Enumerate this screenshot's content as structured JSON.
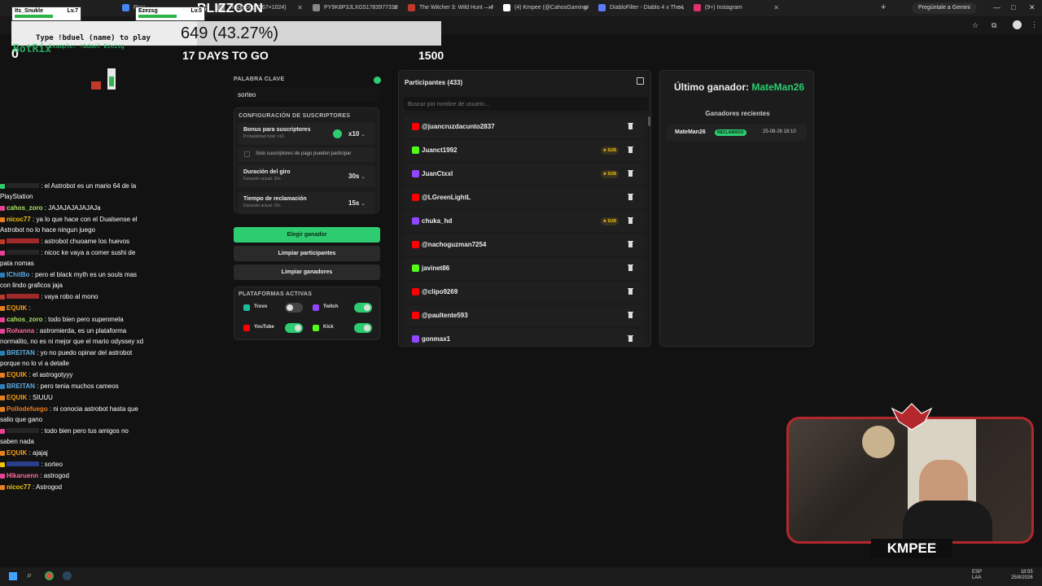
{
  "browser": {
    "tabs": [
      {
        "label": "Prec",
        "color": "#4285f4"
      },
      {
        "label": "image.png (567×1024)",
        "color": "#888888"
      },
      {
        "label": "PY9K8P3JLXG5178397731077",
        "color": "#888888"
      },
      {
        "label": "The Witcher 3: Wild Hunt — R",
        "color": "#c0392b"
      },
      {
        "label": "(4) Kmpee (@CahosGamingAI",
        "color": "#ffffff"
      },
      {
        "label": "DiabloFilter - Diablo 4 x The W",
        "color": "#5b7cfa"
      },
      {
        "label": "(9+) Instagram",
        "color": "#e1306c"
      }
    ],
    "gemini_label": "Pregúntale a Gemini"
  },
  "overlay": {
    "game_title": "BLIZZCON",
    "goal_text": "649 (43.27%)",
    "goal_fraction": 0.4327,
    "days_text": "17 DAYS TO GO",
    "goal_target": "1500",
    "goal_current": "0",
    "duel_hint": "Type !bduel (name) to play",
    "duel_example": "Example: !bduel Ezezsg",
    "player1": "Its_Snukle",
    "player1_level": "Lv.7",
    "player2": "Ezezsg",
    "player2_level": "Lv.5",
    "streamer": "KMPEE",
    "bot_name": "BotRix"
  },
  "chat": [
    {
      "user": "",
      "text": "el Astrobot es un mario 64 de la PlayStation",
      "color": "#ffffff",
      "badge": "#2ecc71"
    },
    {
      "user": "cahos_zoro",
      "text": "JAJAJAJAJAJAJa",
      "color": "#a8e063",
      "badge": "#e84393"
    },
    {
      "user": "nicoc77",
      "text": "ya lo que hace con el Dualsense el Astrobot no lo hace ningun juego",
      "color": "#f1c40f",
      "badge": "#e67e22"
    },
    {
      "user": "",
      "text": "astrobot chuoame los huevos",
      "color": "#ff3b3b",
      "badge": "#c0392b"
    },
    {
      "user": "",
      "text": "nicoc ke vaya a comer sushi de pata nomas",
      "color": "#ffffff",
      "badge": "#e84393"
    },
    {
      "user": "IChitBo",
      "text": "pero el black myth es un souls mas con lindo graficos jaja",
      "color": "#5dade2",
      "badge": "#2980b9"
    },
    {
      "user": "",
      "text": "vaya robo al mono",
      "color": "#ff3b3b",
      "badge": "#c0392b"
    },
    {
      "user": "EQUIK",
      "text": "",
      "color": "#f39c12",
      "badge": "#e67e22"
    },
    {
      "user": "cahos_zoro",
      "text": "todo bien pero xupenmela",
      "color": "#a8e063",
      "badge": "#e84393"
    },
    {
      "user": "Rohanna",
      "text": "astromierda, es un plataforma normalito, no es ni mejor que el mario odyssey xd",
      "color": "#ff6b9d",
      "badge": "#e84393"
    },
    {
      "user": "BREITAN",
      "text": "yo no puedo opinar del astrobot porque no lo vi a detalle",
      "color": "#5dade2",
      "badge": "#2980b9"
    },
    {
      "user": "EQUIK",
      "text": "el astrogotyyy",
      "color": "#f39c12",
      "badge": "#e67e22"
    },
    {
      "user": "BREITAN",
      "text": "pero tenia muchos cameos",
      "color": "#5dade2",
      "badge": "#2980b9"
    },
    {
      "user": "EQUIK",
      "text": "SIUUU",
      "color": "#f39c12",
      "badge": "#e67e22"
    },
    {
      "user": "Pollodefuego",
      "text": "ni conocia astrobot hasta que salio que gano",
      "color": "#e67e22",
      "badge": "#e67e22"
    },
    {
      "user": "",
      "text": "todo bien pero tus amigos no saben nada",
      "color": "#ffffff",
      "badge": "#e84393"
    },
    {
      "user": "EQUIK",
      "text": "ajajaj",
      "color": "#f39c12",
      "badge": "#e67e22"
    },
    {
      "user": "",
      "text": "sorteo",
      "color": "#3b5bdb",
      "badge": "#f1c40f"
    },
    {
      "user": "Hikaruenn",
      "text": "astrogod",
      "color": "#ff6b9d",
      "badge": "#e84393"
    },
    {
      "user": "nicoc77",
      "text": "Astrogod",
      "color": "#f1c40f",
      "badge": "#e67e22"
    }
  ],
  "settings": {
    "keyword_label": "PALABRA CLAVE",
    "keyword_value": "sorteo",
    "subs_config_label": "CONFIGURACIÓN DE SUSCRIPTORES",
    "bonus_title": "Bonus para suscriptores",
    "bonus_sub": "Probabilidad total: x10",
    "bonus_value": "x10",
    "only_subs_label": "Solo suscriptores de pago pueden participar",
    "spin_title": "Duración del giro",
    "spin_sub": "Duración actual: 30s",
    "spin_value": "30s",
    "claim_title": "Tiempo de reclamación",
    "claim_sub": "Duración actual: 15s",
    "claim_value": "15s",
    "pick_winner": "Elegir ganador",
    "clear_participants": "Limpiar participantes",
    "clear_winners": "Limpiar ganadores",
    "platforms_label": "PLATAFORMAS ACTIVAS",
    "platforms": [
      {
        "name": "Trovo",
        "on": false,
        "color": "#1abc9c"
      },
      {
        "name": "Twitch",
        "on": true,
        "color": "#9146ff"
      },
      {
        "name": "YouTube",
        "on": true,
        "color": "#ff0000"
      },
      {
        "name": "Kick",
        "on": true,
        "color": "#53fc18"
      }
    ]
  },
  "participants": {
    "title": "Participantes (433)",
    "search_placeholder": "Buscar por nombre de usuario...",
    "sub_badge": "SUB",
    "list": [
      {
        "name": "@juancruzdacunto2837",
        "platform": "youtube",
        "sub": false
      },
      {
        "name": "Juanct1992",
        "platform": "kick",
        "sub": true
      },
      {
        "name": "JuanCtxxl",
        "platform": "twitch",
        "sub": true
      },
      {
        "name": "@LGreenLightL",
        "platform": "youtube",
        "sub": false
      },
      {
        "name": "chuka_hd",
        "platform": "twitch",
        "sub": true
      },
      {
        "name": "@nachoguzman7254",
        "platform": "youtube",
        "sub": false
      },
      {
        "name": "javinet86",
        "platform": "kick",
        "sub": false
      },
      {
        "name": "@clipo9269",
        "platform": "youtube",
        "sub": false
      },
      {
        "name": "@paultente593",
        "platform": "youtube",
        "sub": false
      },
      {
        "name": "gonmax1",
        "platform": "twitch",
        "sub": false
      }
    ]
  },
  "winner": {
    "last_label": "Último ganador:",
    "last_name": "MateMan26",
    "recent_label": "Ganadores recientes",
    "recent": [
      {
        "name": "MateMan26",
        "status": "RECLAMADO",
        "date": "25-08-26 18:10"
      }
    ]
  },
  "taskbar": {
    "lang": "ESP",
    "lang2": "LAA",
    "time": "18:55",
    "date": "25/8/2026"
  },
  "colors": {
    "accent": "#2ecc71",
    "youtube": "#ff0000",
    "kick": "#53fc18",
    "twitch": "#9146ff"
  }
}
